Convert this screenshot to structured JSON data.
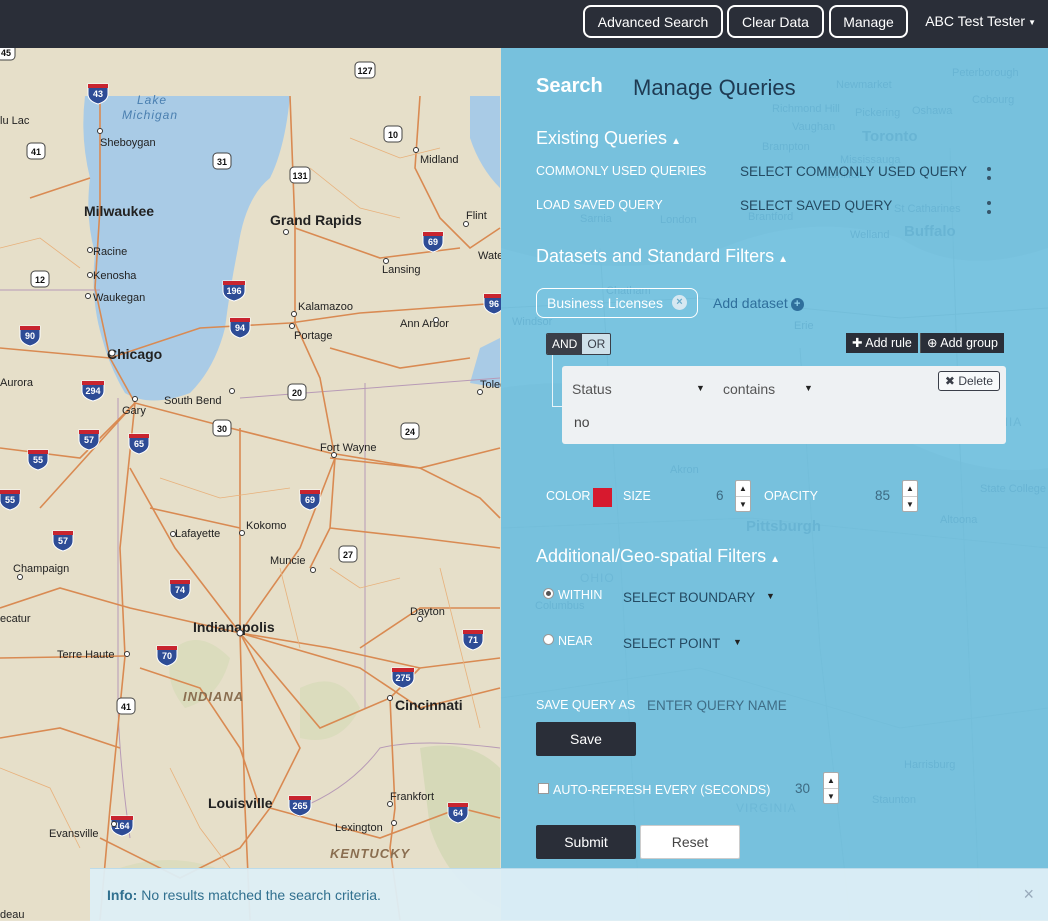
{
  "nav": {
    "advanced_search": "Advanced Search",
    "clear_data": "Clear Data",
    "manage": "Manage",
    "user": "ABC Test Tester"
  },
  "map": {
    "cities": [
      "Milwaukee",
      "Grand Rapids",
      "Chicago",
      "Indianapolis",
      "Cincinnati",
      "Louisville",
      "Sheboygan",
      "Midland",
      "Flint",
      "Racine",
      "Kenosha",
      "Waukegan",
      "Lansing",
      "Kalamazoo",
      "Portage",
      "Ann Arbor",
      "Gary",
      "South Bend",
      "Fort Wayne",
      "Toledo",
      "Aurora",
      "Lafayette",
      "Kokomo",
      "Muncie",
      "Champaign",
      "Terre Haute",
      "Dayton",
      "Frankfort",
      "Lexington",
      "Evansville",
      "lu Lac",
      "Water",
      "ecatur",
      "deau"
    ],
    "regions": [
      "INDIANA",
      "KENTUCKY"
    ],
    "lake": "Lake Michigan",
    "interstates": [
      "43",
      "94",
      "196",
      "94",
      "90",
      "294",
      "57",
      "65",
      "55",
      "69",
      "55",
      "57",
      "74",
      "70",
      "74",
      "71",
      "275",
      "164",
      "265",
      "64",
      "69",
      "96"
    ],
    "us_routes": [
      "127",
      "10",
      "31",
      "131",
      "41",
      "12",
      "20",
      "30",
      "24",
      "27",
      "41",
      "45"
    ],
    "overlay_places": [
      "Peterborough",
      "Newmarket",
      "Oshawa",
      "Cobourg",
      "Richmond Hill",
      "Pickering",
      "Vaughan",
      "Toronto",
      "Brampton",
      "Mississauga",
      "Hamilton",
      "St Catharines",
      "Buffalo",
      "Welland",
      "Sarnia",
      "London",
      "Brantford",
      "Chatham",
      "Windsor",
      "Erie",
      "Cleveland",
      "Akron",
      "Pittsburgh",
      "Altoona",
      "State College",
      "Harrisburg",
      "Staunton",
      "Columbus",
      "OHIO",
      "PENNSYLVANIA",
      "VIRGINIA"
    ]
  },
  "panel": {
    "tabs": {
      "search": "Search",
      "manage": "Manage Queries"
    },
    "existing": {
      "title": "Existing Queries",
      "common_label": "COMMONLY USED QUERIES",
      "common_select": "SELECT COMMONLY USED QUERY",
      "saved_label": "LOAD SAVED QUERY",
      "saved_select": "SELECT SAVED QUERY"
    },
    "datasets": {
      "title": "Datasets and Standard Filters",
      "chip": "Business Licenses",
      "add_dataset": "Add dataset",
      "and": "AND",
      "or": "OR",
      "add_rule": "Add rule",
      "add_group": "Add group",
      "rule": {
        "field": "Status",
        "operator": "contains",
        "value": "no",
        "delete": "Delete"
      },
      "color_label": "COLOR",
      "color_value": "#d7192e",
      "size_label": "SIZE",
      "size_value": "6",
      "opacity_label": "OPACITY",
      "opacity_value": "85"
    },
    "geo": {
      "title": "Additional/Geo-spatial Filters",
      "within": "WITHIN",
      "within_select": "SELECT BOUNDARY",
      "near": "NEAR",
      "near_select": "SELECT POINT"
    },
    "save": {
      "label": "SAVE QUERY AS",
      "placeholder": "ENTER QUERY NAME",
      "button": "Save"
    },
    "auto_refresh": {
      "label": "AUTO-REFRESH EVERY (SECONDS)",
      "value": "30"
    },
    "submit": "Submit",
    "reset": "Reset"
  },
  "alert": {
    "title": "Info:",
    "message": "No results matched the search criteria.",
    "close": "×"
  }
}
